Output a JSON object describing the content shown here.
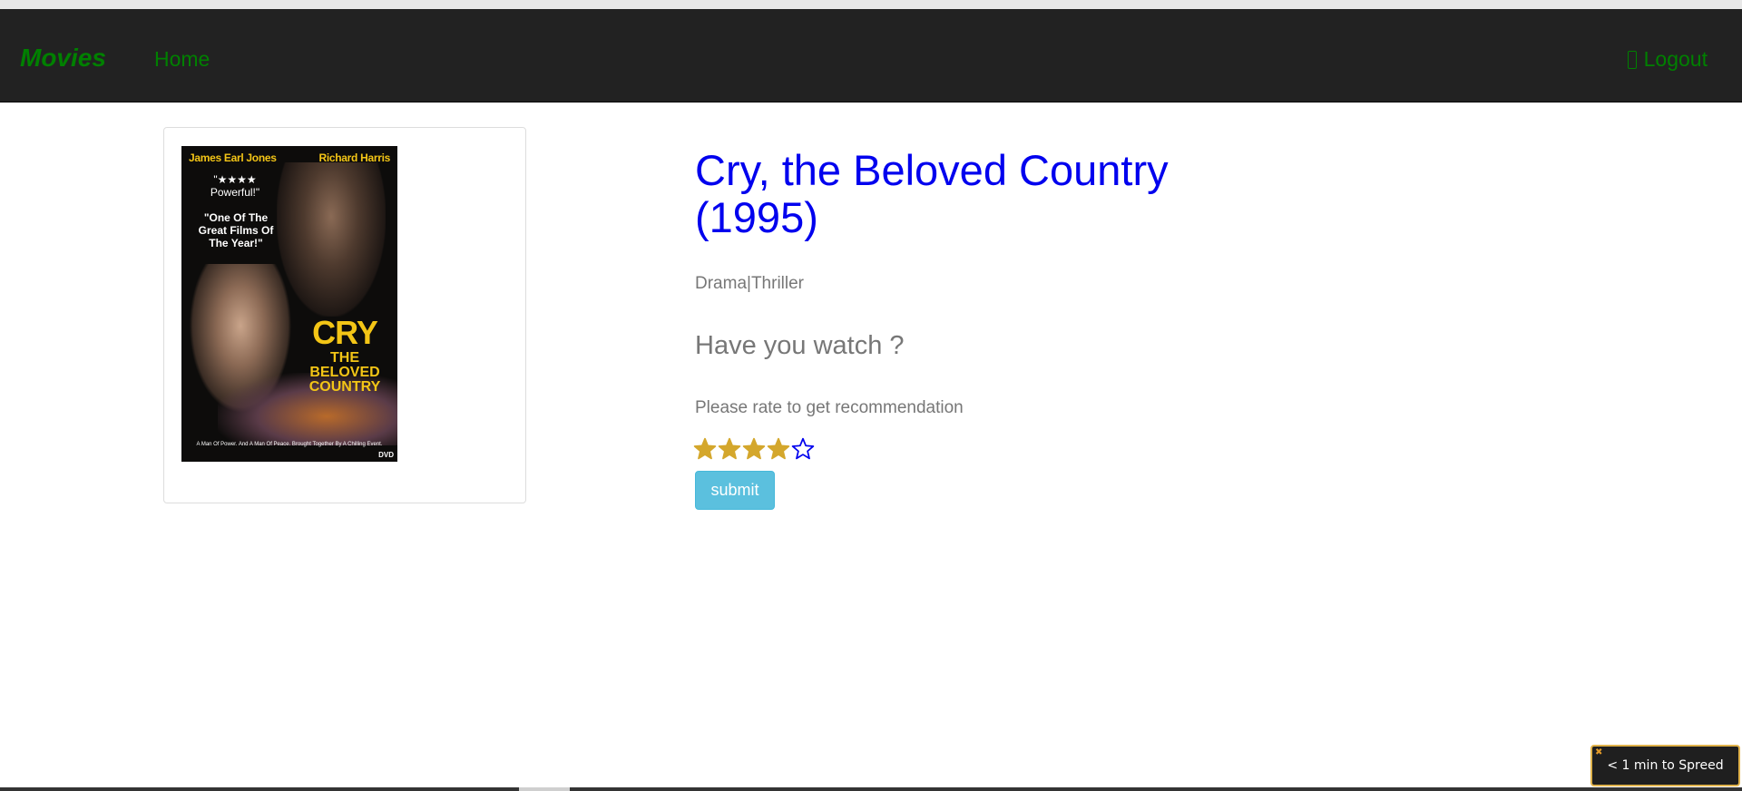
{
  "navbar": {
    "brand": "Movies",
    "home_label": "Home",
    "logout_label": "Logout",
    "link_color": "#008000",
    "background": "#222222"
  },
  "poster": {
    "actor_left": "James Earl Jones",
    "actor_right": "Richard Harris",
    "quote_stars": "\"★★★★",
    "quote1": "Powerful!\"",
    "quote2": "\"One Of The Great Films Of The Year!\"",
    "title_big": "CRY",
    "title_small": "THE BELOVED COUNTRY",
    "tagline": "A Man Of Power. And A Man Of Peace. Brought Together By A Chilling Event.",
    "format": "DVD"
  },
  "movie": {
    "title": "Cry, the Beloved Country (1995)",
    "genres": "Drama|Thriller",
    "title_color": "#0000ee"
  },
  "rating": {
    "question": "Have you watch ?",
    "prompt": "Please rate to get recommendation",
    "value": 4,
    "max": 5,
    "filled_color": "#d4a72c",
    "empty_color": "#0000ee",
    "submit_label": "submit",
    "submit_color": "#5bc0de"
  },
  "toast": {
    "close_icon": "close-icon",
    "text": "< 1 min to Spreed"
  }
}
